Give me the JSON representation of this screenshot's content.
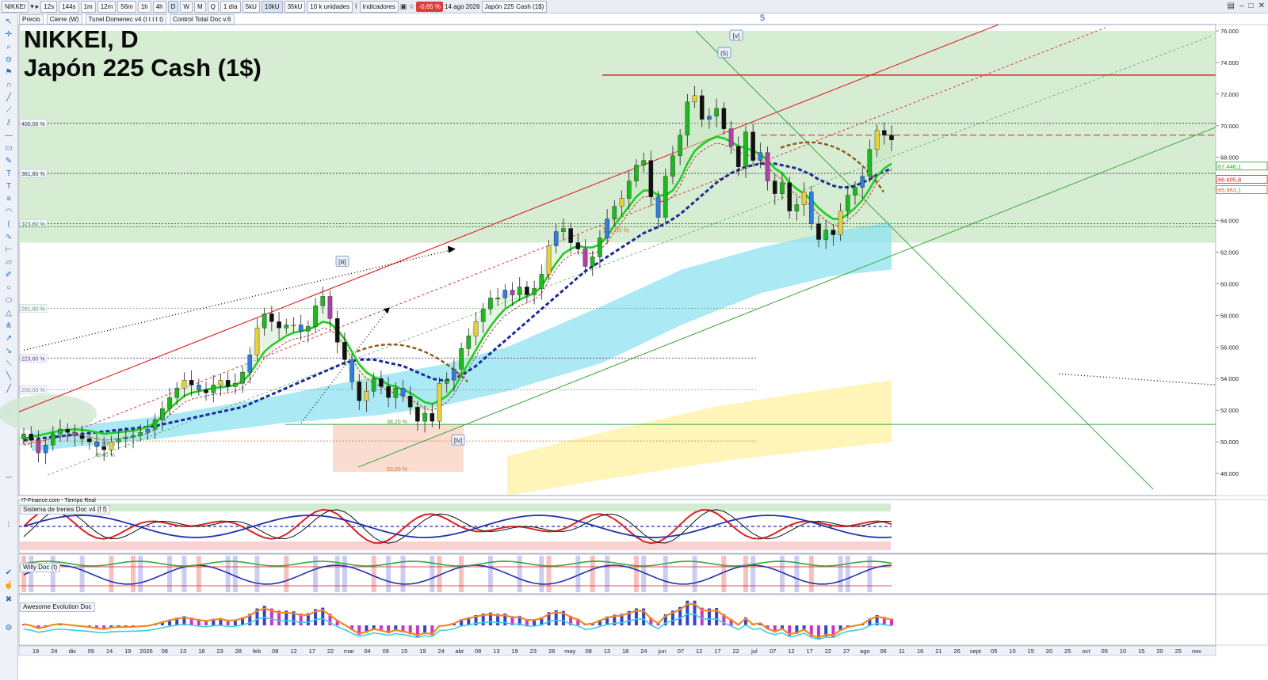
{
  "toolbar": {
    "symbol": "NIKKEI",
    "timeframes": [
      "12s",
      "144s",
      "1m",
      "12m",
      "56m",
      "1h",
      "4h",
      "D",
      "W",
      "M",
      "Q"
    ],
    "period": "1 día",
    "sizes": [
      "5kU",
      "10kU",
      "35kU"
    ],
    "units": "10 k unidades",
    "indicators_label": "Indicadores",
    "change_badge": "-0,65 %",
    "date": "14 ago 2026",
    "instrument": "Japón 225 Cash (1$)"
  },
  "subbar": {
    "items": [
      "Precio",
      "Cierre (W)",
      "Tunel Domenec v4 (t t t t t)",
      "Control Total Doc v.6"
    ]
  },
  "title": {
    "line1": "NIKKEI, D",
    "line2": "Japón 225 Cash (1$)"
  },
  "source_label": "IT-Finance.com - Tiempo Real",
  "panes": {
    "trains": "Sistema de trenes Doc v4 (f f)",
    "willy": "Willy Doc (t)",
    "awesome": "Awesome Evolution Doc"
  },
  "colors": {
    "zone_green": "#c8e6c4",
    "resistance_red": "#e02020",
    "ma_fast": "#22cc22",
    "ma_slow": "#1a2a9a",
    "cloud_cyan": "#8fe3f0",
    "cloud_yellow": "#fff2a8"
  },
  "chart_data": {
    "type": "candlestick",
    "title": "NIKKEI, D",
    "subtitle": "Japón 225 Cash (1$)",
    "y_axis": {
      "ticks": [
        "48.000",
        "50.000",
        "52.000",
        "54.000",
        "56.000",
        "58.000",
        "60.000",
        "62.000",
        "64.000",
        "66.000",
        "68.000",
        "70.000",
        "72.000",
        "74.000",
        "76.000"
      ],
      "range": [
        46600,
        76400
      ]
    },
    "x_axis": {
      "ticks": [
        "19",
        "24",
        "dic",
        "09",
        "14",
        "19",
        "2026",
        "08",
        "13",
        "18",
        "23",
        "28",
        "feb",
        "08",
        "12",
        "17",
        "22",
        "mar",
        "04",
        "09",
        "15",
        "19",
        "24",
        "abr",
        "08",
        "13",
        "19",
        "23",
        "28",
        "may",
        "08",
        "13",
        "18",
        "24",
        "jun",
        "07",
        "12",
        "17",
        "22",
        "jul",
        "07",
        "12",
        "17",
        "22",
        "27",
        "ago",
        "06",
        "11",
        "16",
        "21",
        "26",
        "sept",
        "05",
        "10",
        "15",
        "20",
        "25",
        "oct",
        "05",
        "10",
        "15",
        "20",
        "25",
        "nov"
      ]
    },
    "price_markers": [
      {
        "label": "67.446,1",
        "value": 67446,
        "color": "#22aa22"
      },
      {
        "label": "66.605,8",
        "value": 66606,
        "color": "#cc2222"
      },
      {
        "label": "65.963,1",
        "value": 65963,
        "color": "#c0682a"
      }
    ],
    "fib_levels": [
      {
        "label": "400,00 %",
        "value": 70150
      },
      {
        "label": "361,80 %",
        "value": 66980
      },
      {
        "label": "323,60 %",
        "value": 63800
      },
      {
        "label": "261,80 %",
        "value": 58450
      },
      {
        "label": "223,60 %",
        "value": 55300
      },
      {
        "label": "200,00 %",
        "value": 53300
      },
      {
        "label": "161,80 %",
        "value": 50050
      }
    ],
    "annotations": [
      "[iii]",
      "[iv]",
      "(5)",
      "[v]",
      "5",
      "161,80 %",
      "38,20 %",
      "50,00 %",
      "61,80 %",
      "76,40 %"
    ],
    "closes": [
      50500,
      50100,
      49300,
      49800,
      50500,
      50800,
      50600,
      50400,
      50200,
      50000,
      49700,
      49500,
      50000,
      50200,
      50300,
      50400,
      50600,
      50800,
      51400,
      52100,
      52800,
      53400,
      53900,
      53600,
      53300,
      53100,
      53600,
      53900,
      53500,
      53700,
      54400,
      55500,
      57200,
      58100,
      57600,
      57200,
      57400,
      57400,
      57000,
      57300,
      58600,
      59200,
      57800,
      56300,
      55200,
      53800,
      52600,
      53200,
      54000,
      53500,
      52800,
      53400,
      52900,
      52200,
      51300,
      51800,
      51300,
      53700,
      53900,
      54600,
      55900,
      56700,
      57600,
      58400,
      59100,
      59100,
      59600,
      59300,
      59800,
      59300,
      59700,
      60600,
      62400,
      63300,
      63500,
      62600,
      62200,
      61100,
      61700,
      62900,
      64100,
      64900,
      65400,
      66500,
      67500,
      67800,
      65500,
      64200,
      66800,
      68100,
      69400,
      71500,
      71900,
      70400,
      70600,
      71100,
      69800,
      68700,
      67400,
      69600,
      67800,
      68300,
      66500,
      65700,
      66400,
      64600,
      65000,
      65800,
      63800,
      62800,
      63400,
      63100,
      64600,
      65600,
      66100,
      66800,
      68500,
      69700,
      69400,
      69100
    ],
    "ma_fast": [
      50200,
      50300,
      50400,
      50500,
      50600,
      50700,
      50750,
      50800,
      50750,
      50700,
      50600,
      50500,
      50550,
      50600,
      50650,
      50700,
      50800,
      50950,
      51200,
      51600,
      52100,
      52500,
      52900,
      53100,
      53200,
      53300,
      53400,
      53450,
      53500,
      53600,
      53800,
      54300,
      55000,
      55700,
      56100,
      56400,
      56700,
      56900,
      57000,
      57100,
      57300,
      57600,
      57500,
      57100,
      56500,
      55700,
      54900,
      54400,
      54100,
      53900,
      53600,
      53500,
      53300,
      53100,
      52800,
      52500,
      52400,
      52600,
      52900,
      53400,
      54200,
      55000,
      55800,
      56600,
      57300,
      57900,
      58400,
      58700,
      59000,
      59200,
      59400,
      59800,
      60600,
      61300,
      61900,
      62200,
      62400,
      62300,
      62300,
      62500,
      63000,
      63700,
      64300,
      64900,
      65500,
      65900,
      65900,
      65600,
      65600,
      65900,
      66600,
      67600,
      68400,
      68800,
      69100,
      69300,
      69200,
      69000,
      68700,
      68600,
      68400,
      68200,
      67800,
      67300,
      67000,
      66400,
      66000,
      65700,
      65300,
      64800,
      64400,
      64100,
      64100,
      64400,
      64800,
      65300,
      66000,
      66800,
      67300,
      67600
    ],
    "ma_slow": [
      50100,
      50150,
      50200,
      50250,
      50300,
      50350,
      50400,
      50450,
      50500,
      50550,
      50600,
      50650,
      50700,
      50750,
      50800,
      50850,
      50900,
      50950,
      51000,
      51100,
      51200,
      51300,
      51400,
      51500,
      51600,
      51700,
      51800,
      51900,
      52000,
      52100,
      52200,
      52400,
      52600,
      52800,
      53000,
      53200,
      53400,
      53600,
      53800,
      54000,
      54200,
      54400,
      54600,
      54800,
      55000,
      55100,
      55200,
      55200,
      55200,
      55100,
      55000,
      54900,
      54800,
      54600,
      54400,
      54200,
      54000,
      53900,
      53900,
      54000,
      54200,
      54500,
      54800,
      55200,
      55600,
      56000,
      56400,
      56800,
      57200,
      57600,
      58000,
      58400,
      58800,
      59200,
      59600,
      60000,
      60400,
      60800,
      61100,
      61400,
      61700,
      62000,
      62300,
      62600,
      62900,
      63200,
      63400,
      63600,
      63800,
      64100,
      64400,
      64800,
      65200,
      65600,
      66000,
      66400,
      66700,
      67000,
      67200,
      67400,
      67500,
      67600,
      67600,
      67600,
      67500,
      67400,
      67300,
      67100,
      66900,
      66600,
      66400,
      66200,
      66100,
      66100,
      66200,
      66400,
      66600,
      66900,
      67100,
      67300
    ]
  }
}
